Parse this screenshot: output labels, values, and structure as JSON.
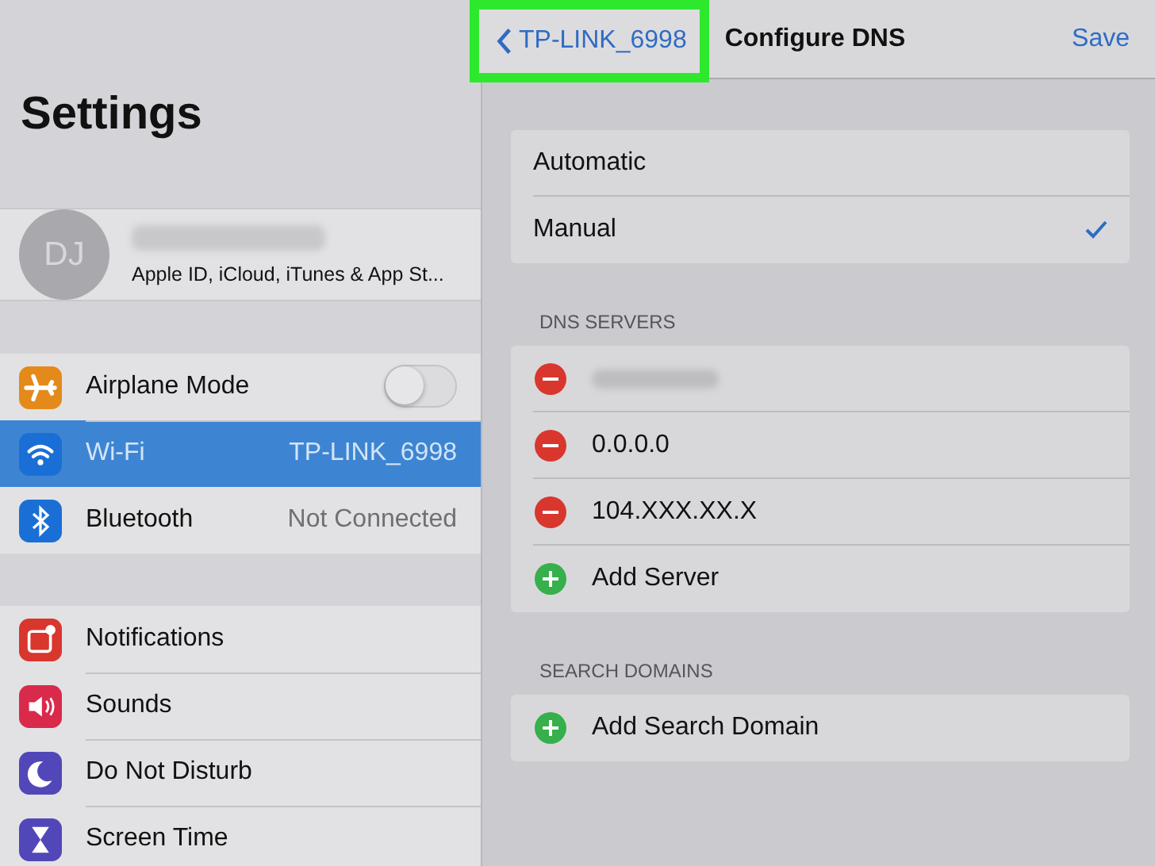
{
  "sidebar": {
    "title": "Settings",
    "profile": {
      "initials": "DJ",
      "subtitle": "Apple ID, iCloud, iTunes & App St..."
    },
    "groups": [
      [
        {
          "label": "Airplane Mode",
          "color": "#e48a1a",
          "kind": "toggle",
          "on": false,
          "selected": false
        },
        {
          "label": "Wi-Fi",
          "color": "#1a6fd6",
          "kind": "value",
          "value": "TP-LINK_6998",
          "selected": true
        },
        {
          "label": "Bluetooth",
          "color": "#1a6fd6",
          "kind": "value",
          "value": "Not Connected",
          "selected": false
        }
      ],
      [
        {
          "label": "Notifications",
          "color": "#d9362e",
          "kind": "plain",
          "selected": false
        },
        {
          "label": "Sounds",
          "color": "#d92a4c",
          "kind": "plain",
          "selected": false
        },
        {
          "label": "Do Not Disturb",
          "color": "#5247b8",
          "kind": "plain",
          "selected": false
        },
        {
          "label": "Screen Time",
          "color": "#5247b8",
          "kind": "plain",
          "selected": false
        }
      ]
    ]
  },
  "nav": {
    "back": "TP-LINK_6998",
    "title": "Configure DNS",
    "action": "Save"
  },
  "dns_mode": [
    {
      "label": "Automatic",
      "selected": false
    },
    {
      "label": "Manual",
      "selected": true
    }
  ],
  "dns_servers": {
    "header": "DNS SERVERS",
    "rows": [
      {
        "kind": "remove",
        "blurred": true
      },
      {
        "kind": "remove",
        "label": "0.0.0.0"
      },
      {
        "kind": "remove",
        "label": "104.XXX.XX.X"
      },
      {
        "kind": "add",
        "label": "Add Server"
      }
    ]
  },
  "search_domains": {
    "header": "SEARCH DOMAINS",
    "rows": [
      {
        "kind": "add",
        "label": "Add Search Domain"
      }
    ]
  }
}
